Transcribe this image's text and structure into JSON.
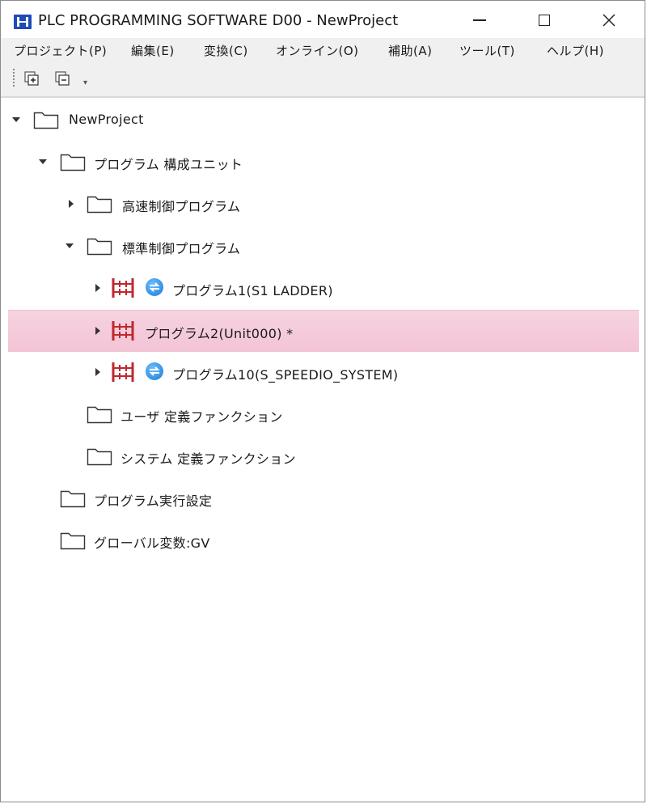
{
  "window": {
    "title": "PLC PROGRAMMING SOFTWARE D00 - NewProject",
    "minimize_glyph": "—",
    "close_glyph": "✕"
  },
  "menu": [
    "プロジェクト(P)",
    "編集(E)",
    "変換(C)",
    "オンライン(O)",
    "補助(A)",
    "ツール(T)",
    "ヘルプ(H)"
  ],
  "toolbar": {
    "expand_icon": "expand-all-icon",
    "collapse_icon": "collapse-all-icon",
    "overflow_glyph": "▾"
  },
  "tree": [
    {
      "label": "NewProject",
      "icon": "folder-icon",
      "state": "expanded"
    },
    {
      "label": "プログラム 構成ユニット",
      "icon": "folder-icon",
      "state": "expanded"
    },
    {
      "label": "高速制御プログラム",
      "icon": "folder-icon",
      "state": "collapsed"
    },
    {
      "label": "標準制御プログラム",
      "icon": "folder-icon",
      "state": "expanded"
    },
    {
      "label": "プログラム1(S1 LADDER)",
      "icon": "ladder-program-icon",
      "state": "collapsed"
    },
    {
      "label": "プログラム2(Unit000) *",
      "icon": "ladder-program-icon",
      "state": "collapsed",
      "selected": true
    },
    {
      "label": "プログラム10(S_SPEEDIO_SYSTEM)",
      "icon": "ladder-program-icon",
      "state": "collapsed"
    },
    {
      "label": "ユーザ 定義ファンクション",
      "icon": "folder-icon",
      "state": "leaf"
    },
    {
      "label": "システム 定義ファンクション",
      "icon": "folder-icon",
      "state": "leaf"
    },
    {
      "label": "プログラム実行設定",
      "icon": "folder-icon",
      "state": "leaf"
    },
    {
      "label": "グローバル変数:GV",
      "icon": "folder-icon",
      "state": "leaf"
    }
  ],
  "colors": {
    "selection": "#f3c4d6",
    "ladder_icon": "#c0282d",
    "app_icon": "#1e4bb8",
    "linked_icon": "#1a78d8"
  }
}
